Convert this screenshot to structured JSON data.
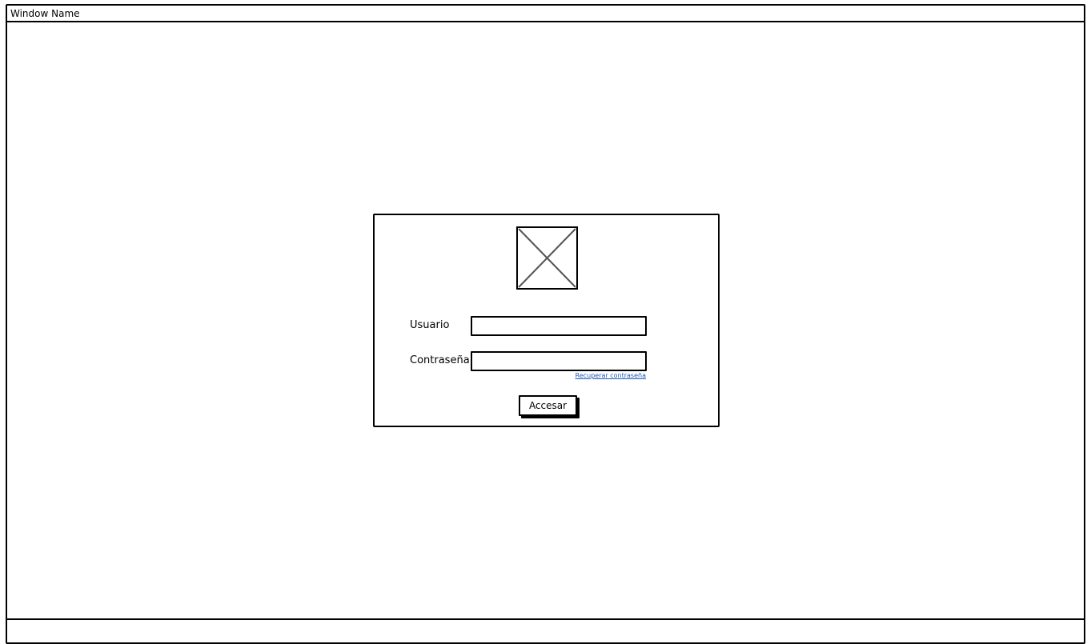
{
  "window": {
    "title": "Window Name"
  },
  "login": {
    "logo_icon": "image-placeholder-icon",
    "username_label": "Usuario",
    "username_value": "",
    "password_label": "Contraseña",
    "password_value": "",
    "forgot_password_link": "Recuperar contraseña",
    "submit_label": "Accesar"
  },
  "colors": {
    "link": "#1a56b8",
    "border": "#000000",
    "background": "#ffffff"
  }
}
